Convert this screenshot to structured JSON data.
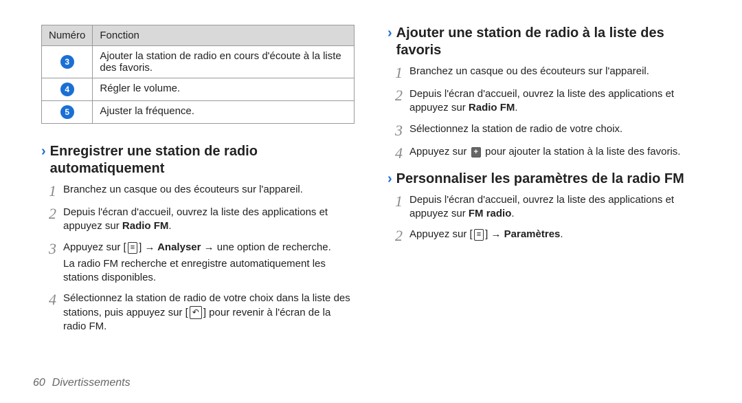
{
  "table": {
    "head": {
      "num": "Numéro",
      "func": "Fonction"
    },
    "rows": [
      {
        "num": "3",
        "func": "Ajouter la station de radio en cours d'écoute à la liste des favoris."
      },
      {
        "num": "4",
        "func": "Régler le volume."
      },
      {
        "num": "5",
        "func": "Ajuster la fréquence."
      }
    ]
  },
  "marks": {
    "chevron": "›",
    "arrow": "→"
  },
  "sectA": {
    "title": "Enregistrer une station de radio automatiquement",
    "s1": "Branchez un casque ou des écouteurs sur l'appareil.",
    "s2a": "Depuis l'écran d'accueil, ouvrez la liste des applications et appuyez sur ",
    "s2b": "Radio FM",
    "s2c": ".",
    "s3a": "Appuyez sur [",
    "s3b": "] ",
    "s3c": " Analyser ",
    "s3d": " une option de recherche.",
    "s3e": "La radio FM recherche et enregistre automatiquement les stations disponibles.",
    "s4a": "Sélectionnez la station de radio de votre choix dans la liste des stations, puis appuyez sur [",
    "s4b": "] pour revenir à l'écran de la radio FM."
  },
  "sectB": {
    "title": "Ajouter une station de radio à la liste des favoris",
    "s1": "Branchez un casque ou des écouteurs sur l'appareil.",
    "s2a": "Depuis l'écran d'accueil, ouvrez la liste des applications et appuyez sur ",
    "s2b": "Radio FM",
    "s2c": ".",
    "s3": "Sélectionnez la station de radio de votre choix.",
    "s4a": "Appuyez sur ",
    "s4b": " pour ajouter la station à la liste des favoris."
  },
  "sectC": {
    "title": "Personnaliser les paramètres de la radio FM",
    "s1a": "Depuis l'écran d'accueil, ouvrez la liste des applications et appuyez sur ",
    "s1b": "FM radio",
    "s1c": ".",
    "s2a": "Appuyez sur [",
    "s2b": "] ",
    "s2c": " Paramètres",
    "s2d": "."
  },
  "footer": {
    "page": "60",
    "section": "Divertissements"
  }
}
